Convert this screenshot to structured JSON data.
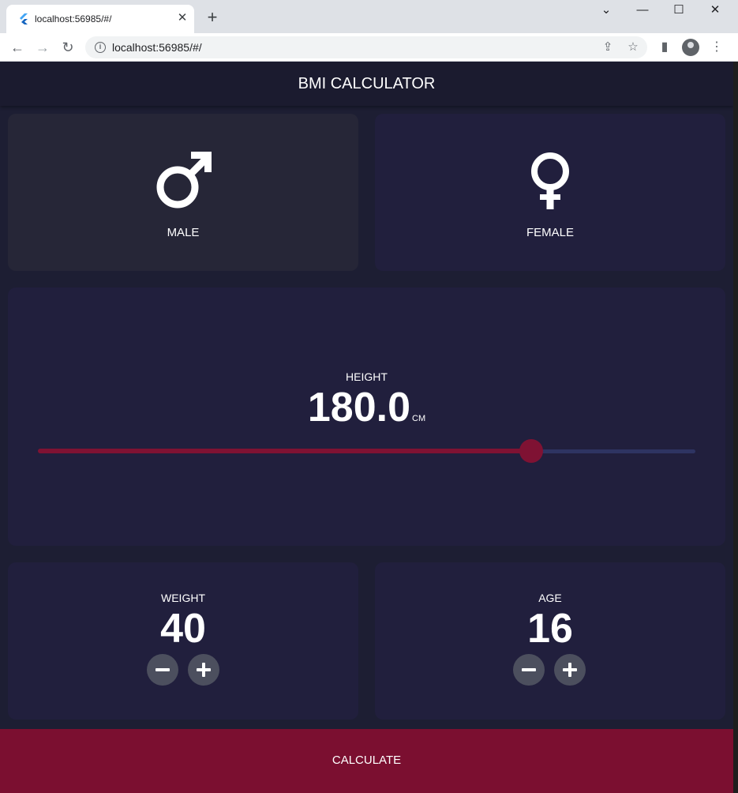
{
  "browser": {
    "tab_title": "localhost:56985/#/",
    "tab_close_glyph": "✕",
    "new_tab_glyph": "+",
    "url": "localhost:56985/#/",
    "window_controls": {
      "dropdown": "⌄",
      "minimize": "—",
      "maximize": "☐",
      "close": "✕"
    },
    "nav": {
      "back": "←",
      "forward": "→",
      "reload": "↻"
    },
    "toolbar_icons": {
      "share": "⇪",
      "bookmark": "☆",
      "side_panel": "▮",
      "menu": "⋮"
    }
  },
  "app": {
    "title": "BMI CALCULATOR",
    "colors": {
      "background": "#1d1e33",
      "card": "#211f3d",
      "card_active": "#262637",
      "accent": "#7b0f30",
      "slider_inactive": "#2e3462",
      "button": "#4c4f5e"
    },
    "gender": {
      "male": {
        "label": "MALE",
        "icon": "male-symbol",
        "selected": true
      },
      "female": {
        "label": "FEMALE",
        "icon": "female-symbol",
        "selected": false
      }
    },
    "height": {
      "label": "HEIGHT",
      "value": "180.0",
      "unit": "CM",
      "slider_fraction": 0.75
    },
    "weight": {
      "label": "WEIGHT",
      "value": "40"
    },
    "age": {
      "label": "AGE",
      "value": "16"
    },
    "calculate_label": "CALCULATE"
  }
}
